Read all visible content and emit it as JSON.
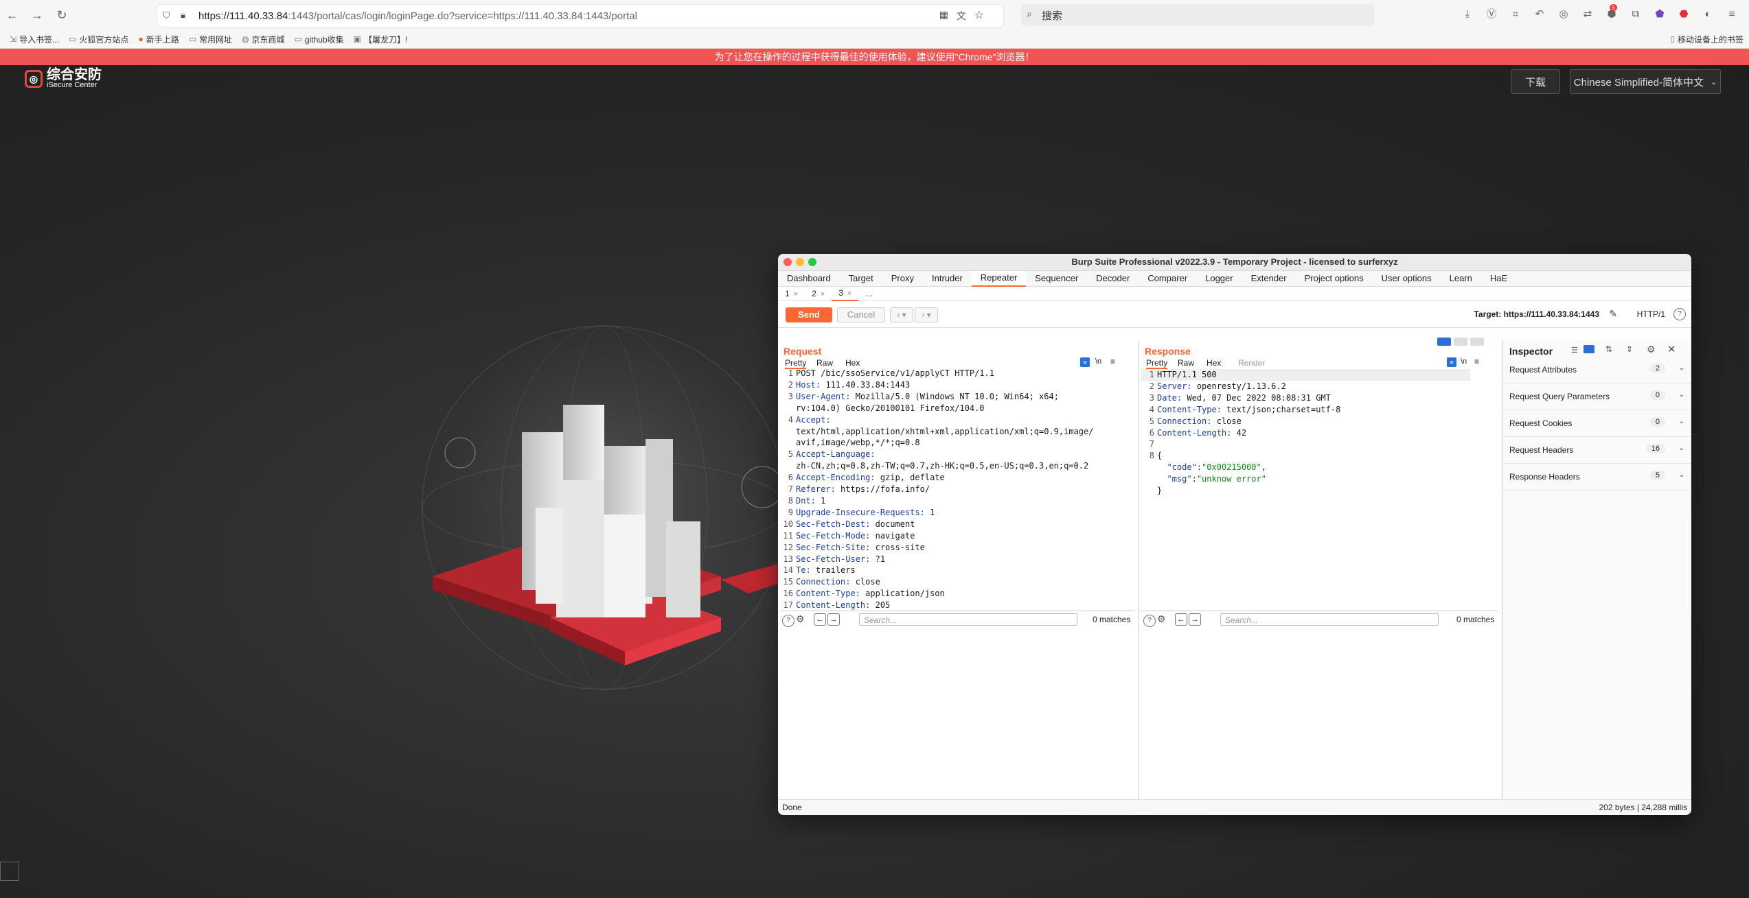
{
  "browser": {
    "url_host": "https://111.40.33.84",
    "url_rest": ":1443/portal/cas/login/loginPage.do?service=https://111.40.33.84:1443/portal",
    "search_placeholder": "搜索",
    "bookmarks": [
      "导入书签...",
      "火狐官方站点",
      "新手上路",
      "常用网址",
      "京东商城",
      "github收集",
      "【屠龙刀】!"
    ],
    "mobile_bookmarks": "移动设备上的书签",
    "badge_count": "5"
  },
  "banner": {
    "text": "为了让您在操作的过程中获得最佳的使用体验，建议使用\"Chrome\"浏览器！"
  },
  "site": {
    "logo_cn": "综合安防",
    "logo_en": "iSecure Center",
    "download_label": "下载",
    "language_label": "Chinese Simplified-简体中文"
  },
  "burp": {
    "title": "Burp Suite Professional v2022.3.9 - Temporary Project - licensed to surferxyz",
    "tabs": [
      "Dashboard",
      "Target",
      "Proxy",
      "Intruder",
      "Repeater",
      "Sequencer",
      "Decoder",
      "Comparer",
      "Logger",
      "Extender",
      "Project options",
      "User options",
      "Learn",
      "HaE"
    ],
    "active_tab": "Repeater",
    "subtabs": [
      "1",
      "2",
      "3",
      "..."
    ],
    "send_label": "Send",
    "cancel_label": "Cancel",
    "target_label": "Target: https://111.40.33.84:1443",
    "http_version": "HTTP/1",
    "request": {
      "title": "Request",
      "views": [
        "Pretty",
        "Raw",
        "Hex"
      ],
      "search_placeholder": "Search...",
      "matches": "0 matches"
    },
    "response": {
      "title": "Response",
      "views": [
        "Pretty",
        "Raw",
        "Hex",
        "Render"
      ],
      "search_placeholder": "Search...",
      "matches": "0 matches"
    },
    "inspector": {
      "title": "Inspector",
      "rows": [
        {
          "label": "Request Attributes",
          "count": "2"
        },
        {
          "label": "Request Query Parameters",
          "count": "0"
        },
        {
          "label": "Request Cookies",
          "count": "0"
        },
        {
          "label": "Request Headers",
          "count": "16"
        },
        {
          "label": "Response Headers",
          "count": "5"
        }
      ]
    },
    "status_left": "Done",
    "status_right": "202 bytes | 24,288 millis"
  }
}
